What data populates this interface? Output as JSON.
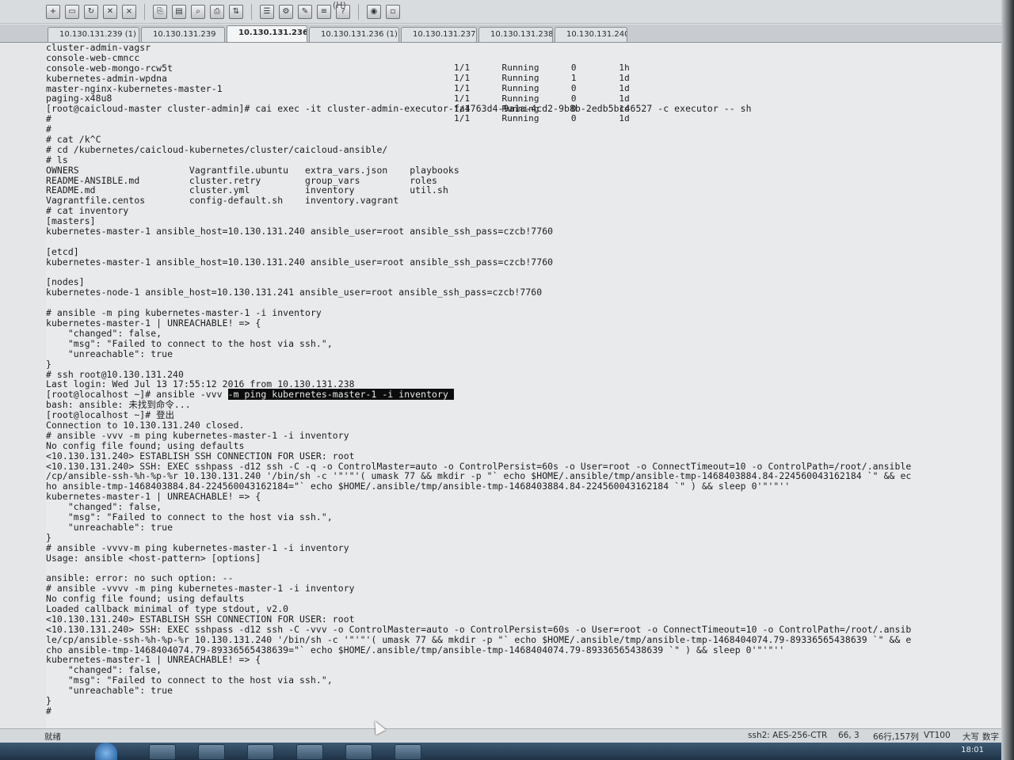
{
  "toolbar": {
    "menu_text": "(H)",
    "icons": [
      "new-session-icon",
      "open-icon",
      "reconnect-icon",
      "disconnect-icon",
      "close-icon",
      "copy-icon",
      "paste-icon",
      "find-icon",
      "print-icon",
      "transfer-icon",
      "properties-icon",
      "settings-icon",
      "tools-icon",
      "script-icon",
      "help-icon",
      "globe-icon",
      "unknown-icon"
    ]
  },
  "tabs": [
    {
      "label": "10.130.131.239 (1)",
      "active": false
    },
    {
      "label": "10.130.131.239",
      "active": false
    },
    {
      "label": "10.130.131.236",
      "active": true
    },
    {
      "label": "10.130.131.236 (1)",
      "active": false
    },
    {
      "label": "10.130.131.237",
      "active": false
    },
    {
      "label": "10.130.131.238",
      "active": false
    },
    {
      "label": "10.130.131.240",
      "active": false
    }
  ],
  "terminal": {
    "lines": [
      "cluster-admin-vagsr",
      "console-web-cmncc",
      "console-web-mongo-rcw5t",
      "kubernetes-admin-wpdna",
      "master-nginx-kubernetes-master-1",
      "paging-x48u8",
      "[root@caicloud-master cluster-admin]# cai exec -it cluster-admin-executor-fa4763d4-9a1a-4cd2-9b8b-2edb5bc46527 -c executor -- sh",
      "#",
      "#",
      "# cat /k^C",
      "# cd /kubernetes/caicloud-kubernetes/cluster/caicloud-ansible/",
      "# ls",
      "OWNERS                    Vagrantfile.ubuntu   extra_vars.json    playbooks",
      "README-ANSIBLE.md         cluster.retry        group_vars         roles",
      "README.md                 cluster.yml          inventory          util.sh",
      "Vagrantfile.centos        config-default.sh    inventory.vagrant",
      "# cat inventory",
      "[masters]",
      "kubernetes-master-1 ansible_host=10.130.131.240 ansible_user=root ansible_ssh_pass=czcb!7760",
      "",
      "[etcd]",
      "kubernetes-master-1 ansible_host=10.130.131.240 ansible_user=root ansible_ssh_pass=czcb!7760",
      "",
      "[nodes]",
      "kubernetes-node-1 ansible_host=10.130.131.241 ansible_user=root ansible_ssh_pass=czcb!7760",
      "",
      "# ansible -m ping kubernetes-master-1 -i inventory",
      "kubernetes-master-1 | UNREACHABLE! => {",
      "    \"changed\": false,",
      "    \"msg\": \"Failed to connect to the host via ssh.\",",
      "    \"unreachable\": true",
      "}",
      "# ssh root@10.130.131.240",
      "Last login: Wed Jul 13 17:55:12 2016 from 10.130.131.238",
      "[root@localhost ~]# ansible -vvv ",
      "bash: ansible: 未找到命令...",
      "[root@localhost ~]# 登出",
      "Connection to 10.130.131.240 closed.",
      "# ansible -vvv -m ping kubernetes-master-1 -i inventory",
      "No config file found; using defaults",
      "<10.130.131.240> ESTABLISH SSH CONNECTION FOR USER: root",
      "<10.130.131.240> SSH: EXEC sshpass -d12 ssh -C -q -o ControlMaster=auto -o ControlPersist=60s -o User=root -o ConnectTimeout=10 -o ControlPath=/root/.ansible",
      "/cp/ansible-ssh-%h-%p-%r 10.130.131.240 '/bin/sh -c '\"'\"'( umask 77 && mkdir -p \"` echo $HOME/.ansible/tmp/ansible-tmp-1468403884.84-224560043162184 `\" && ec",
      "ho ansible-tmp-1468403884.84-224560043162184=\"` echo $HOME/.ansible/tmp/ansible-tmp-1468403884.84-224560043162184 `\" ) && sleep 0'\"'\"''",
      "kubernetes-master-1 | UNREACHABLE! => {",
      "    \"changed\": false,",
      "    \"msg\": \"Failed to connect to the host via ssh.\",",
      "    \"unreachable\": true",
      "}",
      "# ansible -vvvv-m ping kubernetes-master-1 -i inventory",
      "Usage: ansible <host-pattern> [options]",
      "",
      "ansible: error: no such option: --",
      "# ansible -vvvv -m ping kubernetes-master-1 -i inventory",
      "No config file found; using defaults",
      "Loaded callback minimal of type stdout, v2.0",
      "<10.130.131.240> ESTABLISH SSH CONNECTION FOR USER: root",
      "<10.130.131.240> SSH: EXEC sshpass -d12 ssh -C -vvv -o ControlMaster=auto -o ControlPersist=60s -o User=root -o ConnectTimeout=10 -o ControlPath=/root/.ansib",
      "le/cp/ansible-ssh-%h-%p-%r 10.130.131.240 '/bin/sh -c '\"'\"'( umask 77 && mkdir -p \"` echo $HOME/.ansible/tmp/ansible-tmp-1468404074.79-89336565438639 `\" && e",
      "cho ansible-tmp-1468404074.79-89336565438639=\"` echo $HOME/.ansible/tmp/ansible-tmp-1468404074.79-89336565438639 `\" ) && sleep 0'\"'\"''",
      "kubernetes-master-1 | UNREACHABLE! => {",
      "    \"changed\": false,",
      "    \"msg\": \"Failed to connect to the host via ssh.\",",
      "    \"unreachable\": true",
      "}",
      "#"
    ],
    "highlight_line_index": 34,
    "highlight_text": "-m ping kubernetes-master-1 -i inventory ",
    "pods": [
      "1/1      Running      0        1h",
      "1/1      Running      1        1d",
      "1/1      Running      0        1d",
      "1/1      Running      0        1d",
      "1/1      Running      0        1d",
      "1/1      Running      0        1d"
    ]
  },
  "statusbar": {
    "ready": "就绪",
    "encryption": "ssh2: AES-256-CTR",
    "cursor": "66,  3",
    "size": "66行,157列",
    "emulation": "VT100",
    "caps": "大写",
    "num": "数字"
  },
  "taskbar": {
    "clock": "18:01"
  }
}
